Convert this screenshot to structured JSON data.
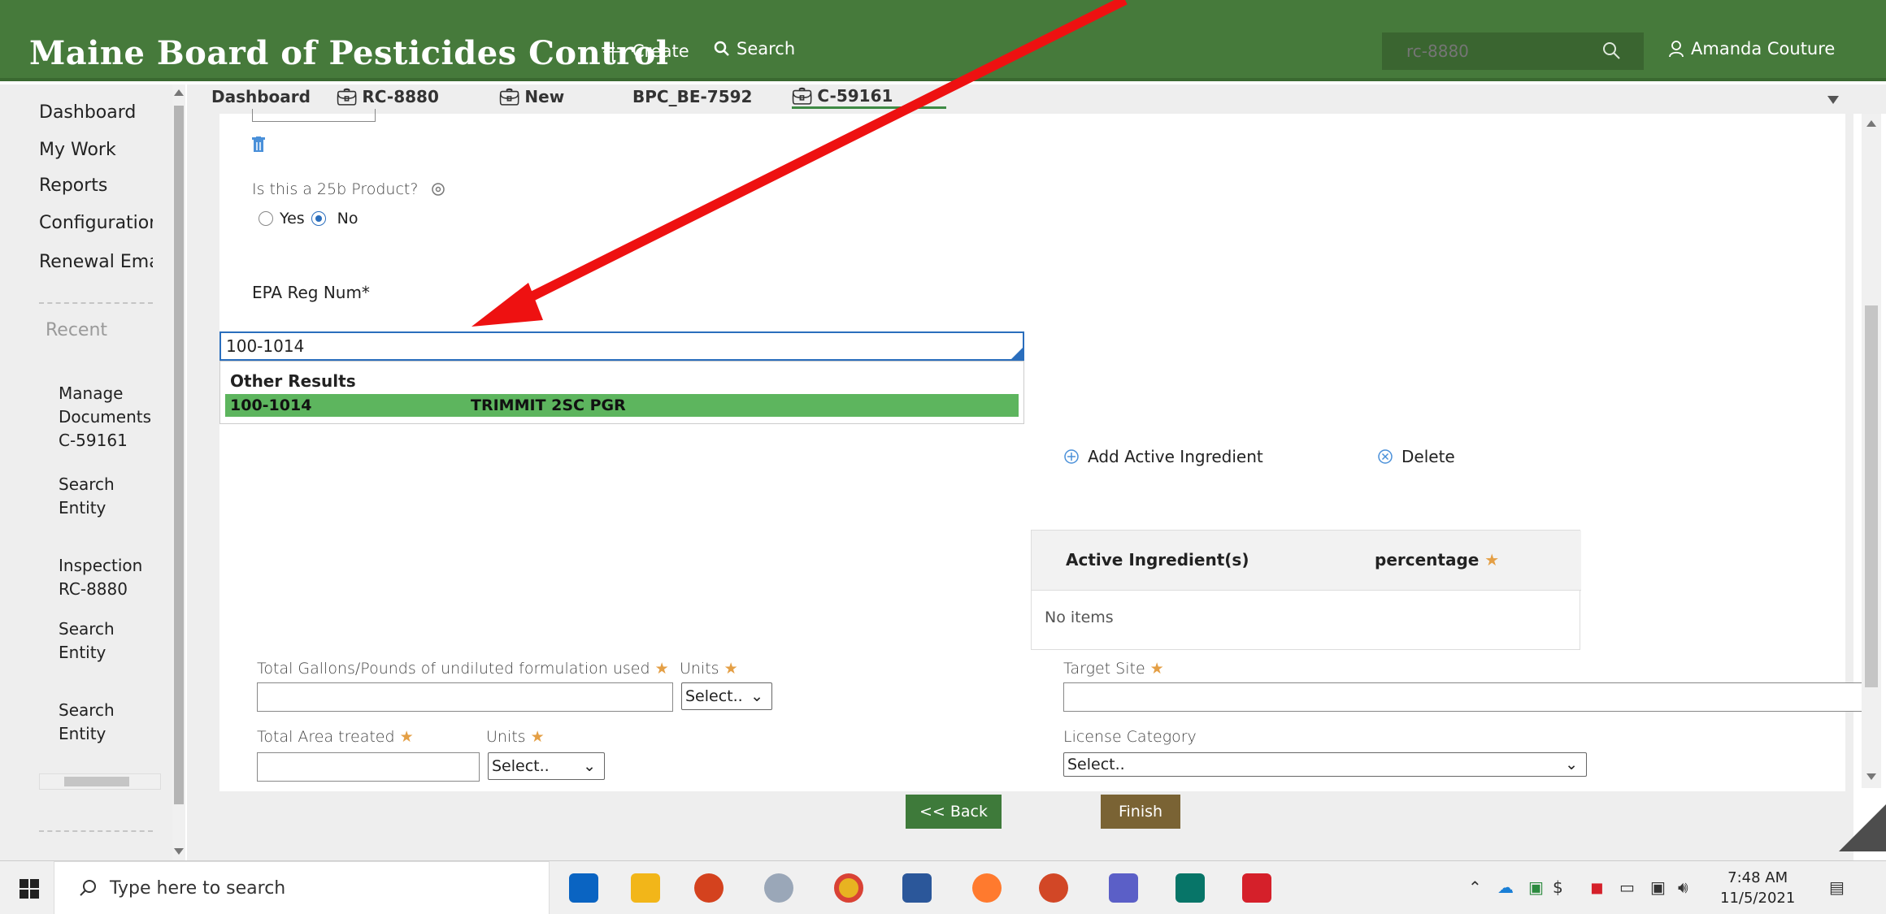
{
  "header": {
    "title": "Maine Board of Pesticides Control",
    "create_label": "Create",
    "search_label": "Search",
    "search_placeholder": "rc-8880",
    "user_name": "Amanda Couture",
    "brand_color": "#467a3b"
  },
  "sidebar": {
    "nav": [
      "Dashboard",
      "My Work",
      "Reports",
      "Configuratior",
      "Renewal Ema"
    ],
    "recent_label": "Recent",
    "recent": [
      {
        "label": "Manage Documents C-59161"
      },
      {
        "label": "Search Entity"
      },
      {
        "label": "Inspection RC-8880"
      },
      {
        "label": "Search Entity"
      },
      {
        "label": "Search Entity"
      }
    ]
  },
  "tabs": [
    {
      "label": "Dashboard",
      "icon": null
    },
    {
      "label": "RC-8880",
      "icon": "briefcase-icon"
    },
    {
      "label": "New",
      "icon": "briefcase-icon"
    },
    {
      "label": "BPC_BE-7592",
      "icon": null
    },
    {
      "label": "C-59161",
      "icon": "briefcase-icon",
      "active": true
    }
  ],
  "form": {
    "question_25b": "Is this a 25b Product?",
    "yes_label": "Yes",
    "no_label": "No",
    "selected": "No",
    "epa_label": "EPA Reg Num*",
    "epa_value": "100-1014",
    "autocomplete": {
      "header": "Other Results",
      "result_code": "100-1014",
      "result_name": "TRIMMIT 2SC PGR",
      "highlight_color": "#5db55e"
    },
    "add_ingredient_label": "Add Active Ingredient",
    "delete_label": "Delete",
    "table": {
      "col1": "Active Ingredient(s)",
      "col2": "percentage",
      "empty_text": "No items"
    },
    "total_gallons_label": "Total Gallons/Pounds of undiluted formulation used",
    "units_label": "Units",
    "units_select": "Select..",
    "target_site_label": "Target Site",
    "total_area_label": "Total Area treated",
    "units2_label": "Units",
    "units2_select": "Select..",
    "license_category_label": "License Category",
    "license_select": "Select.."
  },
  "buttons": {
    "back": "<< Back",
    "finish": "Finish",
    "back_color": "#3e7a3a",
    "finish_color": "#7a6334"
  },
  "taskbar": {
    "search_placeholder": "Type here to search",
    "time": "7:48 AM",
    "date": "11/5/2021"
  },
  "annotation_color": "#ee1111"
}
